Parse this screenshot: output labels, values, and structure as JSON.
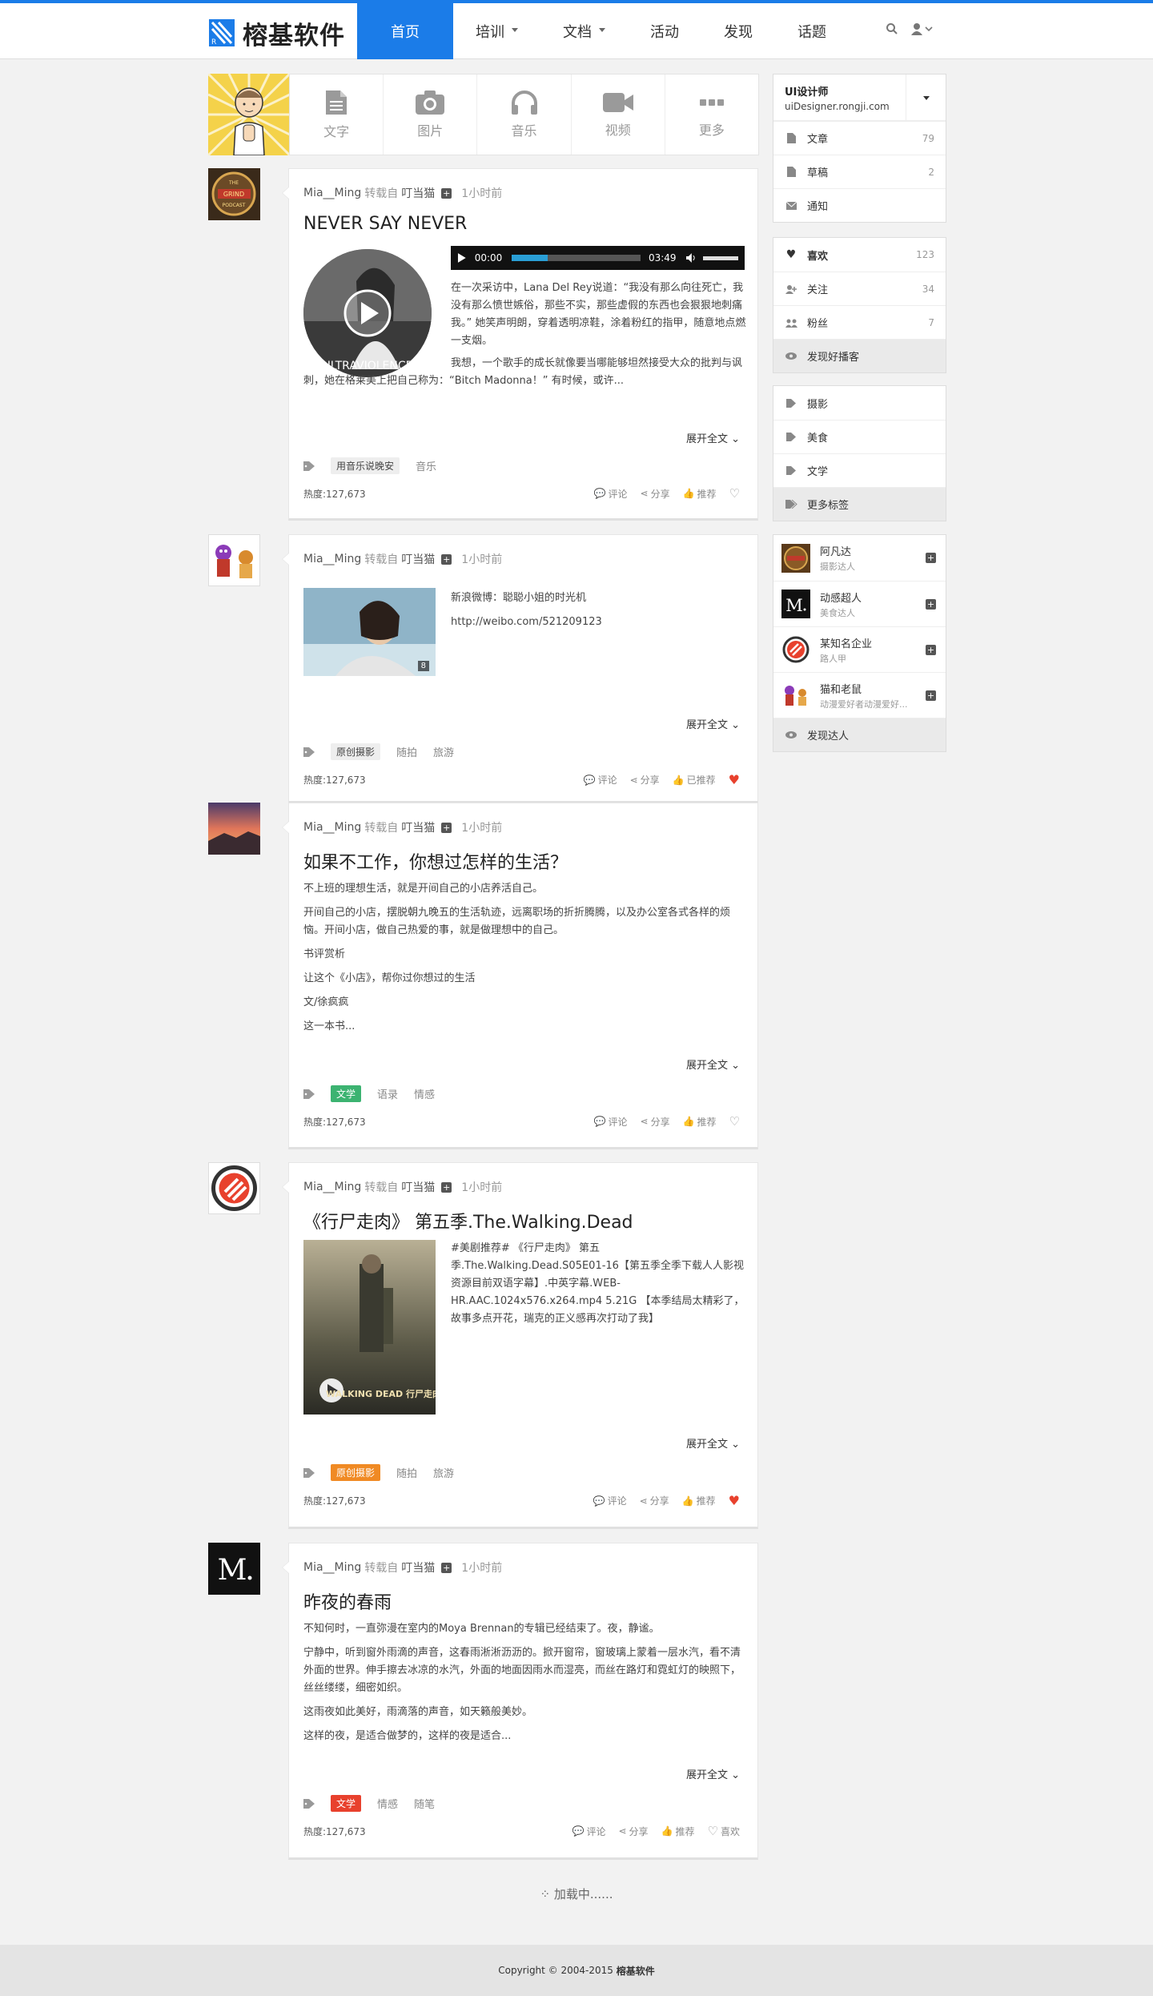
{
  "brand": {
    "name": "榕基软件",
    "accent": "#1b7ce8"
  },
  "nav": {
    "items": [
      {
        "label": "首页"
      },
      {
        "label": "培训"
      },
      {
        "label": "文档"
      },
      {
        "label": "活动"
      },
      {
        "label": "发现"
      },
      {
        "label": "话题"
      }
    ]
  },
  "composer": {
    "buttons": [
      {
        "label": "文字",
        "icon": "document-icon"
      },
      {
        "label": "图片",
        "icon": "camera-icon"
      },
      {
        "label": "音乐",
        "icon": "headphones-icon"
      },
      {
        "label": "视频",
        "icon": "video-icon"
      },
      {
        "label": "更多",
        "icon": "more-icon"
      }
    ]
  },
  "posts": [
    {
      "author": "Mia__Ming",
      "via": "转载自",
      "source": "叮当猫",
      "time": "1小时前",
      "title": "NEVER SAY NEVER",
      "audio": {
        "current": "00:00",
        "total": "03:49",
        "progress": 0.28
      },
      "cover_text": "ULTRAVIOLENCE",
      "p1": "在一次采访中，Lana Del Rey说道：“我没有那么向往死亡，我没有那么愤世嫉俗，那些不实，那些虚假的东西也会狠狠地刺痛我。” 她笑声明朗，穿着透明凉鞋，涂着粉红的指甲，随意地点燃一支烟。",
      "p2": "我想，一个歌手的成长就像要当哪能够坦然接受大众的批判与讽刺，她在格莱美上把自己称为：“Bitch Madonna！” 有时候，或许...",
      "expand": "展开全文",
      "tags": [
        "用音乐说晚安",
        "音乐"
      ],
      "hot": "热度:127,673",
      "actions": {
        "comment": "评论",
        "share": "分享",
        "recommend": "推荐"
      }
    },
    {
      "author": "Mia__Ming",
      "via": "转载自",
      "source": "叮当猫",
      "time": "1小时前",
      "line1": "新浪微博：聪聪小姐的时光机",
      "line2": "http://weibo.com/521209123",
      "img_count": "8",
      "expand": "展开全文",
      "tags": [
        "原创摄影",
        "随拍",
        "旅游"
      ],
      "hot": "热度:127,673",
      "actions": {
        "comment": "评论",
        "share": "分享",
        "recommend": "已推荐"
      }
    },
    {
      "author": "Mia__Ming",
      "via": "转载自",
      "source": "叮当猫",
      "time": "1小时前",
      "title": "如果不工作，你想过怎样的生活？",
      "paras": [
        "不上班的理想生活，就是开间自己的小店养活自己。",
        "开间自己的小店，摆脱朝九晚五的生活轨迹，远离职场的折折腾腾，以及办公室各式各样的烦恼。开间小店，做自己热爱的事，就是做理想中的自己。",
        "书评赏析",
        "让这个《小店》，帮你过你想过的生活",
        "文/徐疯疯",
        "这一本书..."
      ],
      "expand": "展开全文",
      "tags": [
        "文学",
        "语录",
        "情感"
      ],
      "hot": "热度:127,673",
      "actions": {
        "comment": "评论",
        "share": "分享",
        "recommend": "推荐"
      }
    },
    {
      "author": "Mia__Ming",
      "via": "转载自",
      "source": "叮当猫",
      "time": "1小时前",
      "title": "《行尸走肉》 第五季.The.Walking.Dead",
      "text": "#美剧推荐# 《行尸走肉》 第五季.The.Walking.Dead.S05E01-16【第五季全季下载人人影视资源目前双语字幕】.中英字幕.WEB-HR.AAC.1024x576.x264.mp4 5.21G 【本季结局太精彩了，故事多点开花，瑞克的正义感再次打动了我】",
      "poster_text": "WALKING DEAD 行尸走肉",
      "expand": "展开全文",
      "tags": [
        "原创摄影",
        "随拍",
        "旅游"
      ],
      "hot": "热度:127,673",
      "actions": {
        "comment": "评论",
        "share": "分享",
        "recommend": "推荐"
      }
    },
    {
      "author": "Mia__Ming",
      "via": "转载自",
      "source": "叮当猫",
      "time": "1小时前",
      "title": "昨夜的春雨",
      "paras": [
        "不知何时，一直弥漫在室内的Moya Brennan的专辑已经结束了。夜，静谧。",
        "宁静中，听到窗外雨滴的声音，这春雨淅淅沥沥的。掀开窗帘，窗玻璃上蒙着一层水汽，看不清外面的世界。伸手擦去冰凉的水汽，外面的地面因雨水而湿亮，而丝在路灯和霓虹灯的映照下，丝丝缕缕，细密如织。",
        "这雨夜如此美好，雨滴落的声音，如天籁般美妙。",
        "这样的夜，是适合做梦的，这样的夜是适合..."
      ],
      "expand": "展开全文",
      "tags": [
        "文学",
        "情感",
        "随笔"
      ],
      "hot": "热度:127,673",
      "actions": {
        "comment": "评论",
        "share": "分享",
        "recommend": "推荐",
        "like": "喜欢"
      }
    }
  ],
  "sidebar": {
    "user": {
      "name": "UI设计师",
      "site": "uiDesigner.rongji.com"
    },
    "stats": [
      {
        "label": "文章",
        "count": "79"
      },
      {
        "label": "草稿",
        "count": "2"
      },
      {
        "label": "通知",
        "count": ""
      }
    ],
    "social": [
      {
        "label": "喜欢",
        "count": "123"
      },
      {
        "label": "关注",
        "count": "34"
      },
      {
        "label": "粉丝",
        "count": "7"
      },
      {
        "label": "发现好播客",
        "count": ""
      }
    ],
    "tags": [
      {
        "label": "摄影"
      },
      {
        "label": "美食"
      },
      {
        "label": "文学"
      },
      {
        "label": "更多标签"
      }
    ],
    "talents": [
      {
        "name": "阿凡达",
        "desc": "摄影达人"
      },
      {
        "name": "动感超人",
        "desc": "美食达人"
      },
      {
        "name": "某知名企业",
        "desc": "路人甲"
      },
      {
        "name": "猫和老鼠",
        "desc": "动漫爱好者动漫爱好..."
      }
    ],
    "discover_talent": "发现达人"
  },
  "loading": "加载中......",
  "footer": {
    "copyright": "Copyright © 2004-2015",
    "brand": "榕基软件"
  }
}
